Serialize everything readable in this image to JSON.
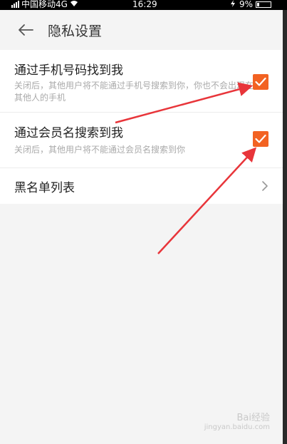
{
  "status_bar": {
    "carrier": "中国移动4G",
    "time": "16:29",
    "battery": "9%"
  },
  "header": {
    "title": "隐私设置"
  },
  "settings": {
    "items": [
      {
        "title": "通过手机号码找到我",
        "description": "关闭后，其他用户将不能通过手机号搜索到你，你也不会出现在其他人的手机",
        "checked": true
      },
      {
        "title": "通过会员名搜索到我",
        "description": "关闭后，其他用户将不能通过会员名搜索到你",
        "checked": true
      },
      {
        "title": "黑名单列表"
      }
    ]
  },
  "annotation": {
    "arrow_color": "#e8353a"
  },
  "watermark": {
    "text": "Bai经验",
    "sub": "jingyan.baidu.com"
  },
  "colors": {
    "accent": "#f26222",
    "background": "#f4f4f4"
  }
}
